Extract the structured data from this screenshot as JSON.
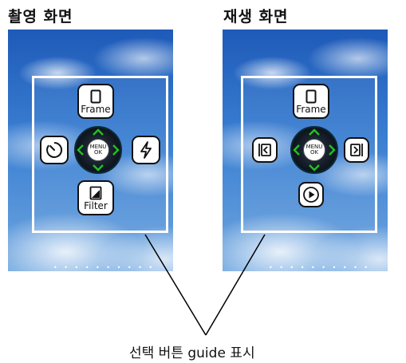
{
  "panels": [
    {
      "title": "촬영 화면",
      "buttons": {
        "top_label": "Frame",
        "bottom_label": "Filter"
      },
      "icons": [
        "frame-icon",
        "self-timer-icon",
        "flash-icon",
        "filter-icon"
      ],
      "dial": {
        "line1": "MENU",
        "line2": "OK"
      },
      "dots": "• • • • • • • • • •"
    },
    {
      "title": "재생 화면",
      "buttons": {
        "top_label": "Frame"
      },
      "icons": [
        "frame-icon",
        "previous-icon",
        "next-icon",
        "play-icon"
      ],
      "dial": {
        "line1": "MENU",
        "line2": "OK"
      },
      "dots": "• • • • • • • • • •"
    }
  ],
  "caption": "선택 버튼 guide 표시",
  "colors": {
    "dial_arrow": "#22c21e",
    "frame_border": "#ffffff",
    "leader_line": "#000000"
  }
}
